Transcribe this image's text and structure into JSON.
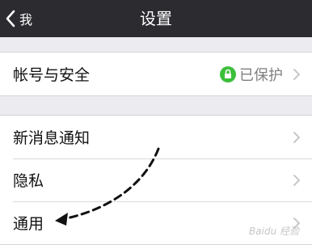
{
  "navbar": {
    "back_label": "我",
    "title": "设置"
  },
  "account_group": {
    "items": [
      {
        "label": "帐号与安全",
        "status": "已保护",
        "status_icon": "lock-icon"
      }
    ]
  },
  "settings_group": {
    "items": [
      {
        "label": "新消息通知"
      },
      {
        "label": "隐私"
      },
      {
        "label": "通用"
      }
    ]
  },
  "colors": {
    "navbar_bg": "#2b2b30",
    "protect_badge": "#3cbf3c",
    "page_bg": "#ebebf0"
  },
  "annotation": {
    "type": "dashed-arrow",
    "points_to": "通用"
  },
  "watermark": "Baidu 经验"
}
